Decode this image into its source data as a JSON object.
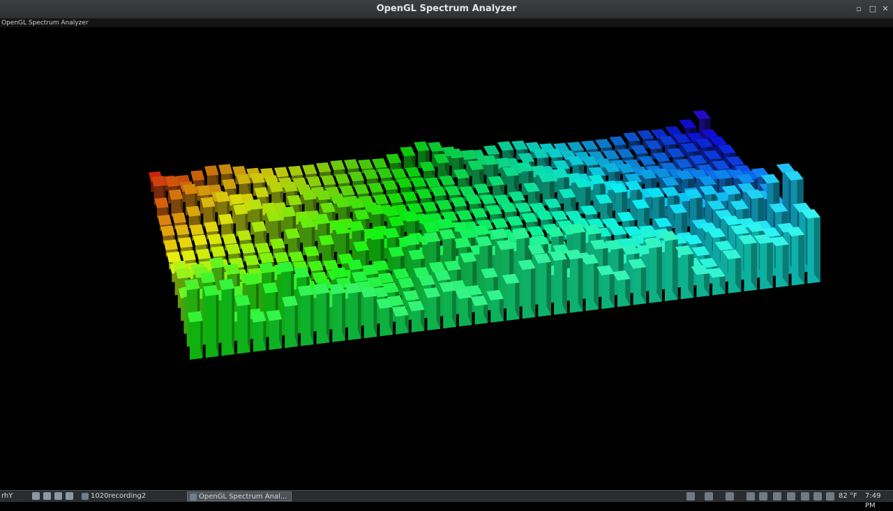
{
  "window": {
    "title": "OpenGL Spectrum Analyzer",
    "app_label": "OpenGL Spectrum Analyzer",
    "controls": [
      "minimize-icon",
      "maximize-icon",
      "close-icon"
    ]
  },
  "colors": {
    "background": "#000000",
    "titlebar": "#2e3134",
    "taskbar": "#2a2d30",
    "row_front": "#1ed84a",
    "row_middle": "#2fa6d0",
    "row_back": "#6a2ad0",
    "accent_red": "#c01818",
    "accent_cyan": "#14e8ff"
  },
  "taskbar": {
    "start_label": "rhY",
    "tasks": [
      {
        "label": "1020recording2",
        "icon": "folder-icon",
        "active": false
      },
      {
        "label": "OpenGL Spectrum Anal...",
        "icon": "window-icon",
        "active": true
      }
    ],
    "tray_icons": [
      "clipboard-icon",
      "network-icon",
      "display-icon",
      "bluetooth-icon",
      "shield-icon",
      "wifi-icon",
      "update-icon",
      "volume-icon",
      "microphone-icon",
      "battery-icon"
    ],
    "temperature": "82 °F",
    "clock": "7:49 PM"
  }
}
